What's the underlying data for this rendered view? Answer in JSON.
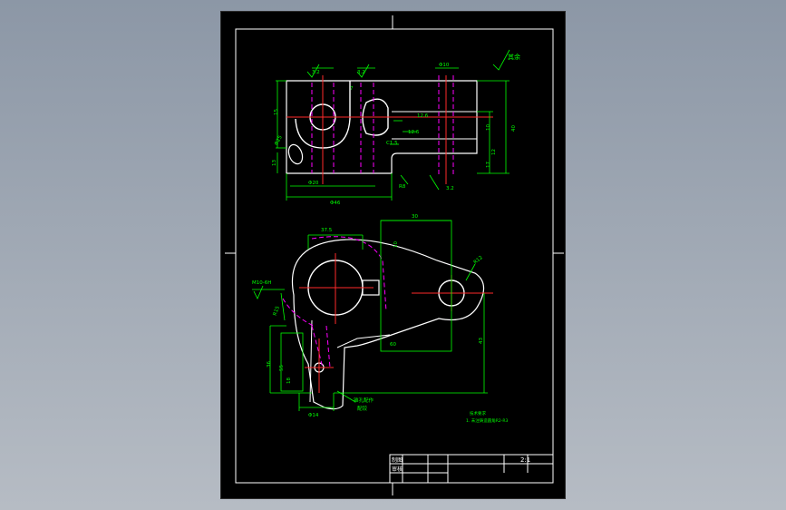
{
  "colors": {
    "background": "#8c97a6",
    "sheet": "#000000",
    "outline": "#ffffff",
    "dimension": "#00ff00",
    "center_line": "#ff2a2a",
    "hidden_line": "#ff00ff"
  },
  "drawing": {
    "scale": "2:1",
    "title_block": {
      "row1_label": "制图",
      "row2_label": "审核"
    },
    "top_view": {
      "dims": {
        "d15": "15",
        "d13": "13",
        "d25": "Φ25",
        "dia46": "Φ46",
        "dia20": "Φ20",
        "dia10": "Φ10",
        "dim7": "7",
        "r126": "12.6",
        "r12": "12.6",
        "d10": "10",
        "d12": "12",
        "d17": "17",
        "d40": "40",
        "r8": "R8",
        "chamfer": "C1.5"
      },
      "roughness": "3.2",
      "note_tr": "其余"
    },
    "front_view": {
      "dims": {
        "d375": "37.5",
        "d30": "30",
        "r": "R12",
        "m10": "M10-6H",
        "d36": "36",
        "d18": "18",
        "d55": "55",
        "d60": "60",
        "d43": "43",
        "dia14": "Φ14",
        "b10": "10",
        "r15": "R15"
      },
      "label_tw": "锥孔配作",
      "label_tw2": "配铰"
    },
    "notes": {
      "title": "技术要求",
      "line1": "1. 未注铸造圆角R2-R3"
    }
  }
}
